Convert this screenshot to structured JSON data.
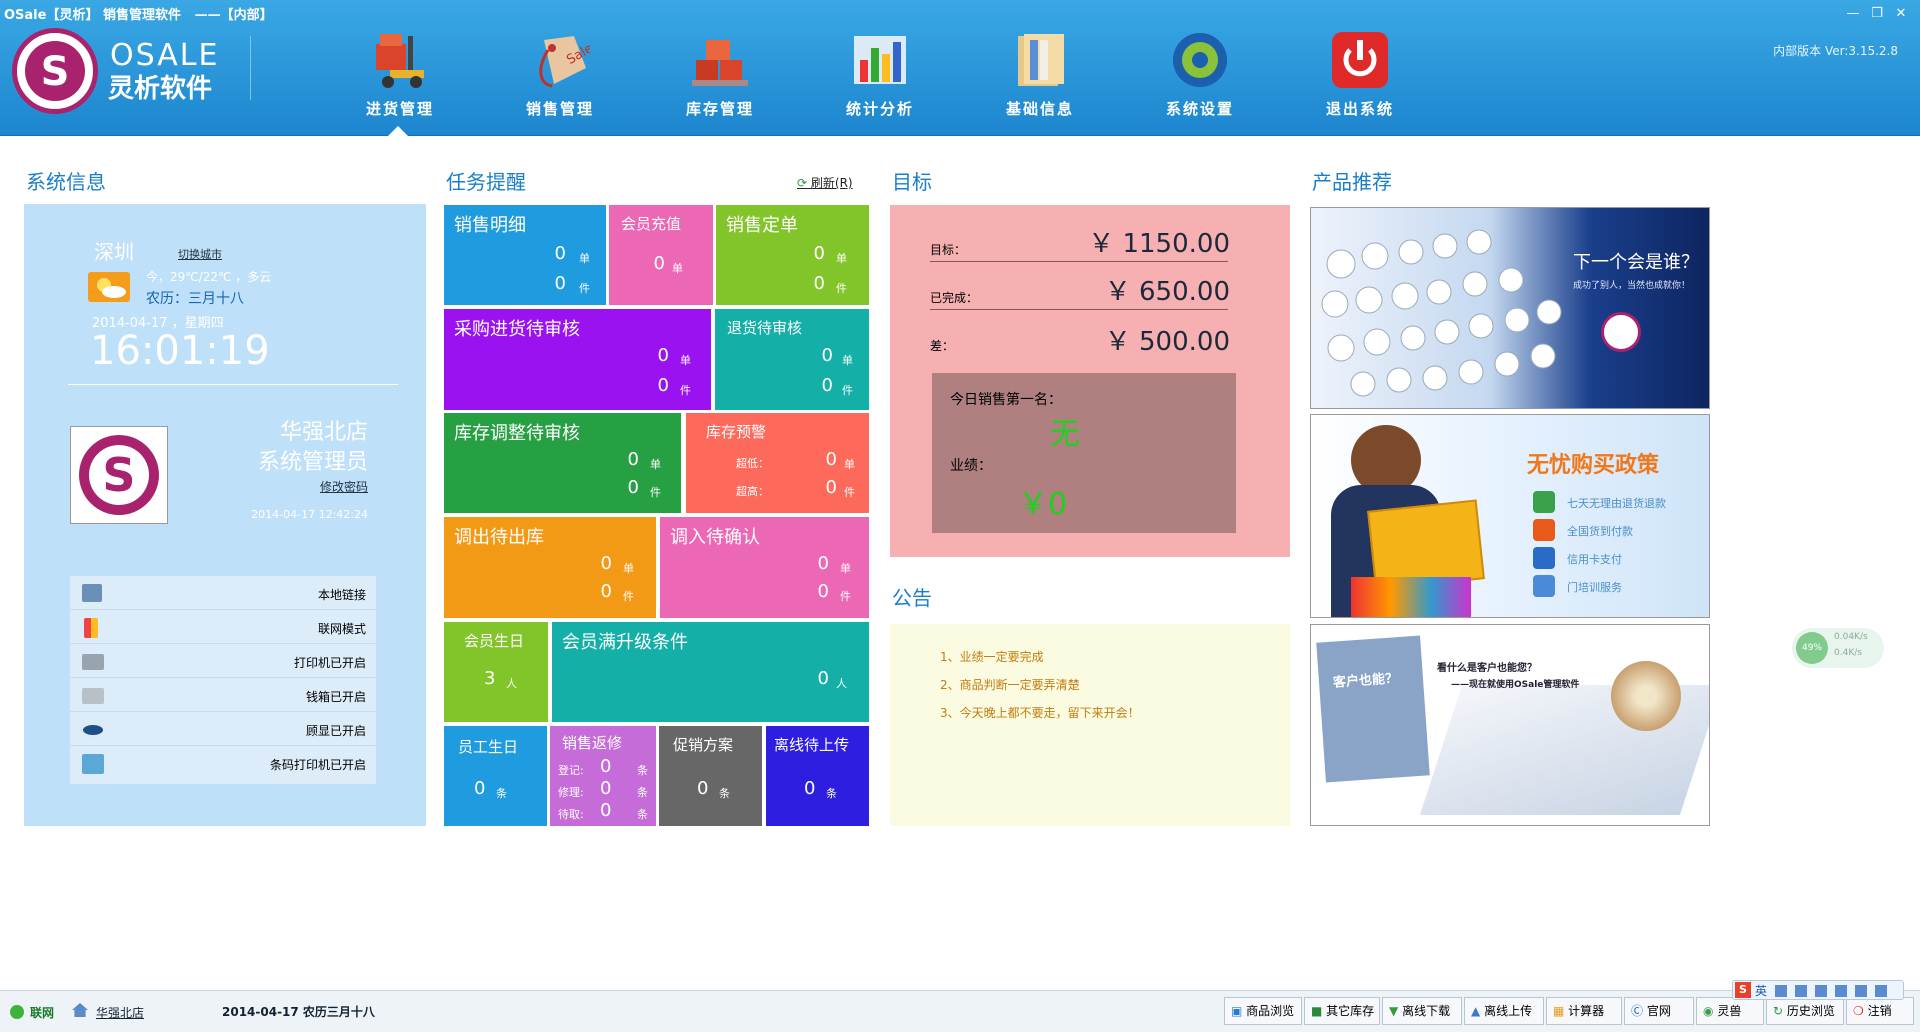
{
  "titlebar": {
    "app_name": "OSale【灵析】 销售管理软件",
    "mode": "——【内部】"
  },
  "version": "内部版本 Ver:3.15.2.8",
  "logo": {
    "en": "OSALE",
    "cn": "灵析软件"
  },
  "nav": [
    {
      "label": "进货管理",
      "icon": "forklift-icon"
    },
    {
      "label": "销售管理",
      "icon": "sale-tag-icon"
    },
    {
      "label": "库存管理",
      "icon": "boxes-icon"
    },
    {
      "label": "统计分析",
      "icon": "bar-chart-icon"
    },
    {
      "label": "基础信息",
      "icon": "folder-icon"
    },
    {
      "label": "系统设置",
      "icon": "gear-icon"
    },
    {
      "label": "退出系统",
      "icon": "power-icon"
    }
  ],
  "sections": {
    "sysinfo": "系统信息",
    "tasks": "任务提醒",
    "target": "目标",
    "notice": "公告",
    "products": "产品推荐"
  },
  "refresh": "刷新(R)",
  "sysinfo": {
    "city": "深圳",
    "switch_city": "切换城市",
    "weather": "今，29℃/22℃ ，多云",
    "lunar": "农历：三月十八",
    "date": "2014-04-17 ，星期四",
    "time": "16:01:19",
    "store": "华强北店",
    "role": "系统管理员",
    "change_pwd": "修改密码",
    "login_time": "2014-04-17 12:42:24",
    "status": [
      {
        "label": "本地链接",
        "icon": "network-icon"
      },
      {
        "label": "联网模式",
        "icon": "mode-icon"
      },
      {
        "label": "打印机已开启",
        "icon": "printer-icon"
      },
      {
        "label": "钱箱已开启",
        "icon": "cashbox-icon"
      },
      {
        "label": "顾显已开启",
        "icon": "eye-icon"
      },
      {
        "label": "条码打印机已开启",
        "icon": "barcode-printer-icon"
      }
    ]
  },
  "tasks": {
    "sales_detail": {
      "title": "销售明细",
      "v1": "0",
      "u1": "单",
      "v2": "0",
      "u2": "件"
    },
    "member_recharge": {
      "title": "会员充值",
      "v1": "0",
      "u1": "单"
    },
    "sales_order": {
      "title": "销售定单",
      "v1": "0",
      "u1": "单",
      "v2": "0",
      "u2": "件"
    },
    "purchase_review": {
      "title": "采购进货待审核",
      "v1": "0",
      "u1": "单",
      "v2": "0",
      "u2": "件"
    },
    "return_review": {
      "title": "退货待审核",
      "v1": "0",
      "u1": "单",
      "v2": "0",
      "u2": "件"
    },
    "stock_adjust": {
      "title": "库存调整待审核",
      "v1": "0",
      "u1": "单",
      "v2": "0",
      "u2": "件"
    },
    "stock_alert": {
      "title": "库存预警",
      "l1": "超低：",
      "v1": "0",
      "u1": "单",
      "l2": "超高：",
      "v2": "0",
      "u2": "件"
    },
    "transfer_out": {
      "title": "调出待出库",
      "v1": "0",
      "u1": "单",
      "v2": "0",
      "u2": "件"
    },
    "transfer_in": {
      "title": "调入待确认",
      "v1": "0",
      "u1": "单",
      "v2": "0",
      "u2": "件"
    },
    "member_birthday": {
      "title": "会员生日",
      "v1": "3",
      "u1": "人"
    },
    "member_upgrade": {
      "title": "会员满升级条件",
      "v1": "0",
      "u1": "人"
    },
    "staff_birthday": {
      "title": "员工生日",
      "v1": "0",
      "u1": "条"
    },
    "sales_repair": {
      "title": "销售返修",
      "l1": "登记:",
      "v1": "0",
      "u1": "条",
      "l2": "修理:",
      "v2": "0",
      "u2": "条",
      "l3": "待取:",
      "v3": "0",
      "u3": "条"
    },
    "promotion": {
      "title": "促销方案",
      "v1": "0",
      "u1": "条"
    },
    "offline_upload": {
      "title": "离线待上传",
      "v1": "0",
      "u1": "条"
    }
  },
  "target": {
    "target_label": "目标：",
    "target_value": "￥ 1150.00",
    "done_label": "已完成：",
    "done_value": "￥ 650.00",
    "diff_label": "差：",
    "diff_value": "￥ 500.00",
    "top_label": "今日销售第一名：",
    "top_value": "无",
    "perf_label": "业绩：",
    "perf_value": "￥0"
  },
  "notice": [
    "1、业绩一定要完成",
    "2、商品判断一定要弄清楚",
    "3、今天晚上都不要走，留下来开会！"
  ],
  "products": {
    "banner1": {
      "headline": "下一个会是谁？",
      "sub": "成功了别人，当然也成就你！"
    },
    "banner2": {
      "headline": "无忧购买政策",
      "items": [
        "七天无理由退货退款",
        "全国货到付款",
        "信用卡支付",
        "门培训服务"
      ]
    },
    "banner3": {
      "note": "客户也能？",
      "headline": "看什么是客户也能您？",
      "sub": "——现在就使用OSale管理软件"
    }
  },
  "netspeed": {
    "percent": "49%",
    "up": "0.04K/s",
    "down": "0.4K/s"
  },
  "footer": {
    "online": "联网",
    "store": "华强北店",
    "date": "2014-04-17 农历三月十八",
    "buttons": [
      {
        "label": "商品浏览",
        "icon": "cart-icon"
      },
      {
        "label": "其它库存",
        "icon": "stock-icon"
      },
      {
        "label": "离线下载",
        "icon": "download-icon"
      },
      {
        "label": "离线上传",
        "icon": "upload-icon"
      },
      {
        "label": "计算器",
        "icon": "calculator-icon"
      },
      {
        "label": "官网",
        "icon": "ie-icon"
      },
      {
        "label": "灵兽",
        "icon": "eye-icon"
      },
      {
        "label": "历史浏览",
        "icon": "history-icon"
      },
      {
        "label": "注销",
        "icon": "logout-icon"
      }
    ]
  },
  "ime": {
    "label": "英"
  },
  "colors": {
    "header": "#2a97da",
    "sysinfo_bg": "#bee0f8",
    "target_bg": "#f6b0b2",
    "notice_bg": "#fafbe0",
    "accent": "#1a7fc8"
  }
}
